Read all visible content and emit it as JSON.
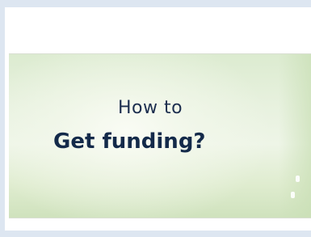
{
  "banner": {
    "line1": "How to",
    "line2": "Get funding?"
  },
  "colors": {
    "page_background": "#dde6f1",
    "panel_background": "#ffffff",
    "banner_green": "#dcebd0",
    "heading_text": "#142a4a"
  }
}
